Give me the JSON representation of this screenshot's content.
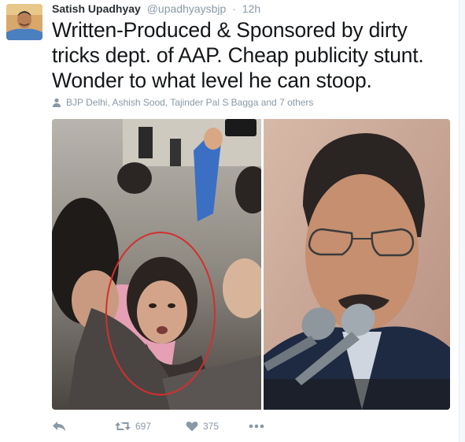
{
  "tweet": {
    "author_name": "Satish Upadhyay",
    "author_handle": "@upadhyaysbjp",
    "separator": "·",
    "timestamp": "12h",
    "text": "Written-Produced & Sponsored by dirty tricks dept. of AAP. Cheap publicity stunt. Wonder to what level he can stoop.",
    "tagged_people": "BJP Delhi, Ashish Sood, Tajinder Pal S Bagga and 7 others"
  },
  "actions": {
    "retweet_count": "697",
    "like_count": "375"
  },
  "icons": {
    "reply": "reply-icon",
    "retweet": "retweet-icon",
    "like": "heart-icon",
    "more": "more-icon",
    "tagged": "person-icon"
  },
  "colors": {
    "text_primary": "#14171a",
    "text_secondary": "#8899a6",
    "annotation_circle": "#d32f2f"
  }
}
